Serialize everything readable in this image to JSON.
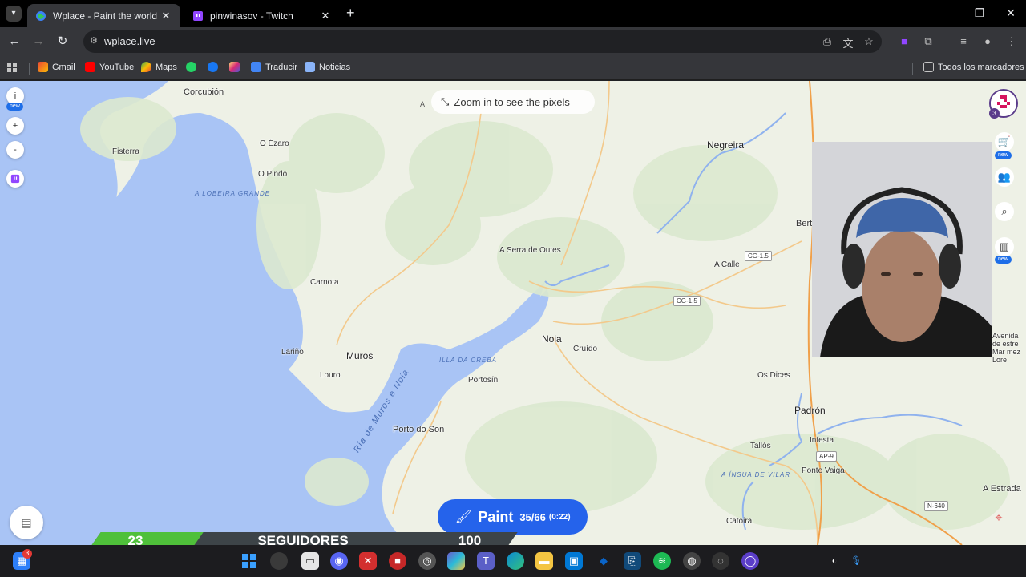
{
  "browser": {
    "tabs": [
      {
        "title": "Wplace - Paint the world",
        "active": true,
        "icon": "globe-icon"
      },
      {
        "title": "pinwinasov - Twitch",
        "active": false,
        "icon": "twitch-icon"
      }
    ],
    "url": "wplace.live",
    "bookmarks": [
      {
        "label": "Gmail",
        "icon": "gmail-icon"
      },
      {
        "label": "YouTube",
        "icon": "youtube-icon"
      },
      {
        "label": "Maps",
        "icon": "maps-icon"
      },
      {
        "label": "",
        "icon": "whatsapp-icon"
      },
      {
        "label": "",
        "icon": "facebook-icon"
      },
      {
        "label": "",
        "icon": "instagram-icon"
      },
      {
        "label": "Traducir",
        "icon": "translate-icon"
      },
      {
        "label": "Noticias",
        "icon": "news-icon"
      }
    ],
    "all_bookmarks": "Todos los marcadores"
  },
  "map": {
    "zoom_hint": "Zoom in to see the pixels",
    "corner_letter": "A",
    "places": [
      {
        "name": "Corcubión"
      },
      {
        "name": "Fisterra"
      },
      {
        "name": "O Ézaro"
      },
      {
        "name": "O Pindo"
      },
      {
        "name": "Negreira"
      },
      {
        "name": "A Serra de Outes"
      },
      {
        "name": "A Calle"
      },
      {
        "name": "Carnota"
      },
      {
        "name": "Noia"
      },
      {
        "name": "Cruído"
      },
      {
        "name": "Lariño"
      },
      {
        "name": "Muros"
      },
      {
        "name": "Louro"
      },
      {
        "name": "Portosín"
      },
      {
        "name": "Porto do Son"
      },
      {
        "name": "Os Dices"
      },
      {
        "name": "Padrón"
      },
      {
        "name": "Infesta"
      },
      {
        "name": "Tallós"
      },
      {
        "name": "Ponte Vaiga"
      },
      {
        "name": "Catoira"
      },
      {
        "name": "A Estrada"
      },
      {
        "name": "Bert"
      }
    ],
    "sea_labels": [
      "A LOBEIRA GRANDE",
      "ILLA DA CREBA",
      "Ría de Muros e Noia",
      "A ÍNSUA DE VILAR"
    ],
    "roads": [
      "CG-1.5",
      "CG-1.5",
      "AP-9",
      "N-640"
    ],
    "edge_text": "Avenida de estre Mar mez Lore"
  },
  "controls": {
    "info_label": "i",
    "new_badge": "new",
    "zoom_in": "+",
    "zoom_out": "-",
    "avatar_count": "3"
  },
  "paint": {
    "label": "Paint",
    "count": "35/66",
    "timer": "(0:22)"
  },
  "follower_bar": {
    "current": "23",
    "label": "SEGUIDORES",
    "goal": "100",
    "progress": 0.23
  },
  "taskbar": {
    "notification_count": "3"
  },
  "colors": {
    "paint_button": "#2563eb",
    "sea": "#a9c4f5",
    "land": "#eef1e6",
    "follower_fill": "#4fc03a"
  }
}
